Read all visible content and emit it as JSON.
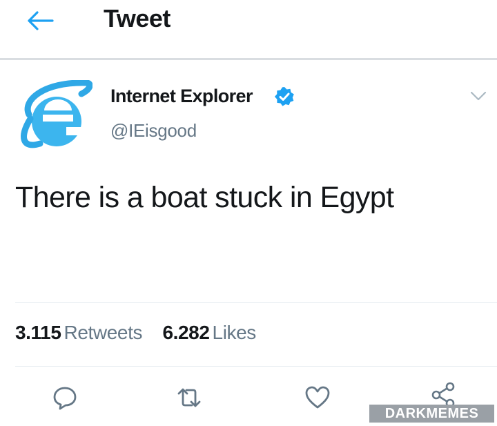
{
  "header": {
    "title": "Tweet",
    "back_icon": "arrow-left-icon",
    "accent_color": "#1da1f2"
  },
  "tweet": {
    "author": {
      "name": "Internet Explorer",
      "handle": "@IEisgood",
      "verified": true,
      "avatar_icon": "internet-explorer-logo-icon"
    },
    "text": "There is a boat stuck in Egypt",
    "stats": {
      "retweets": {
        "count": "3.115",
        "label": "Retweets"
      },
      "likes": {
        "count": "6.282",
        "label": "Likes"
      }
    },
    "actions": [
      "reply-icon",
      "retweet-icon",
      "like-icon",
      "share-icon"
    ]
  },
  "watermark": "DARKMEMES"
}
